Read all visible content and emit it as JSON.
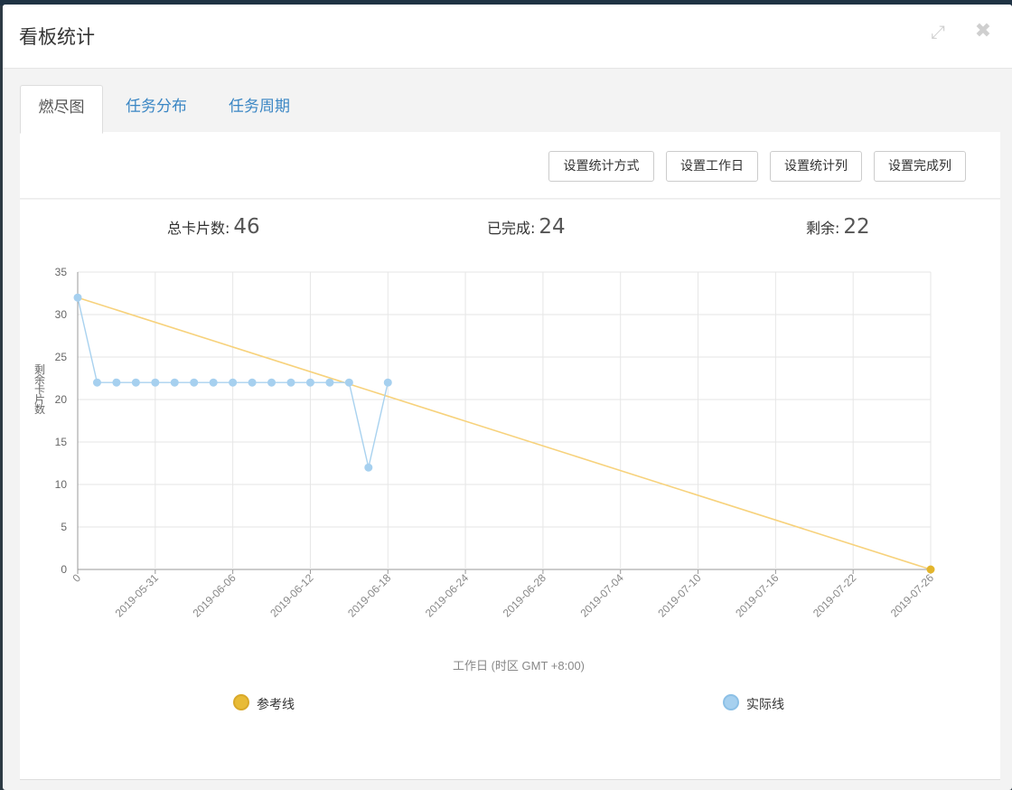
{
  "dialog": {
    "title": "看板统计",
    "expand_icon": "expand-icon",
    "close_icon": "close-icon"
  },
  "tabs": [
    {
      "label": "燃尽图",
      "active": true
    },
    {
      "label": "任务分布",
      "active": false
    },
    {
      "label": "任务周期",
      "active": false
    }
  ],
  "toolbar": {
    "method_label": "设置统计方式",
    "workday_label": "设置工作日",
    "columns_label": "设置统计列",
    "done_label": "设置完成列"
  },
  "stats": {
    "total_label": "总卡片数:",
    "total_value": "46",
    "done_label": "已完成:",
    "done_value": "24",
    "remaining_label": "剩余:",
    "remaining_value": "22"
  },
  "colors": {
    "reference": "#f7d27c",
    "reference_end": "#e3b52c",
    "actual": "#a9d2ef",
    "actual_marker": "#a6d0ef"
  },
  "chart_data": {
    "type": "line",
    "ylabel": "剩余卡片数",
    "xlabel": "工作日 (时区 GMT +8:00)",
    "ylim": [
      0,
      35
    ],
    "yticks": [
      0,
      5,
      10,
      15,
      20,
      25,
      30,
      35
    ],
    "xlim": [
      0,
      44
    ],
    "xticks": [
      {
        "x": 0,
        "label": "0"
      },
      {
        "x": 4,
        "label": "2019-05-31"
      },
      {
        "x": 8,
        "label": "2019-06-06"
      },
      {
        "x": 12,
        "label": "2019-06-12"
      },
      {
        "x": 16,
        "label": "2019-06-18"
      },
      {
        "x": 20,
        "label": "2019-06-24"
      },
      {
        "x": 24,
        "label": "2019-06-28"
      },
      {
        "x": 28,
        "label": "2019-07-04"
      },
      {
        "x": 32,
        "label": "2019-07-10"
      },
      {
        "x": 36,
        "label": "2019-07-16"
      },
      {
        "x": 40,
        "label": "2019-07-22"
      },
      {
        "x": 44,
        "label": "2019-07-26"
      }
    ],
    "grid": true,
    "legend_position": "bottom",
    "series": [
      {
        "name": "参考线",
        "x": [
          0,
          44
        ],
        "y": [
          32,
          0
        ]
      },
      {
        "name": "实际线",
        "x": [
          0,
          1,
          2,
          3,
          4,
          5,
          6,
          7,
          8,
          9,
          10,
          11,
          12,
          13,
          14,
          15,
          16
        ],
        "y": [
          32,
          22,
          22,
          22,
          22,
          22,
          22,
          22,
          22,
          22,
          22,
          22,
          22,
          22,
          22,
          12,
          22
        ]
      }
    ]
  }
}
